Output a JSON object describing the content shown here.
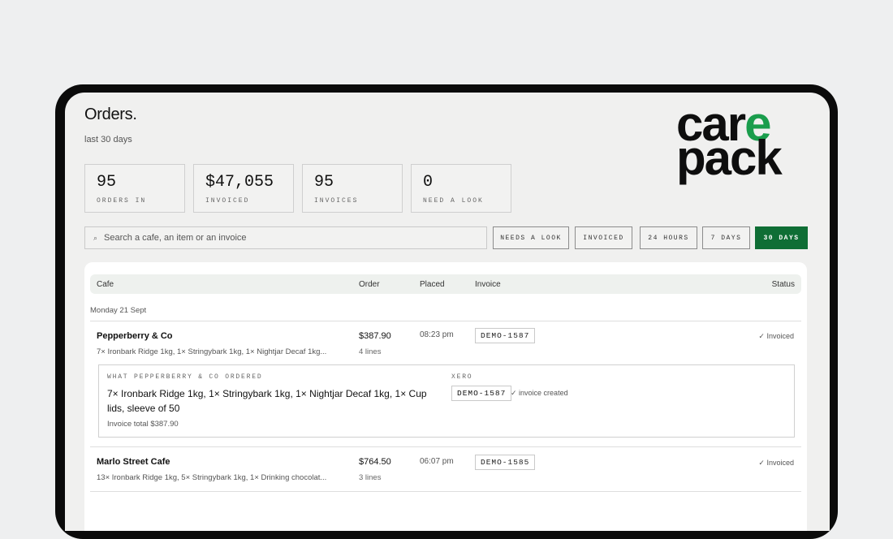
{
  "page": {
    "title": "Orders.",
    "subtitle": "last 30 days"
  },
  "brand": {
    "line1_a": "car",
    "line1_b": "e",
    "line2": "pack",
    "accent_color": "#1a9d4c"
  },
  "stats": [
    {
      "value": "95",
      "label": "ORDERS IN"
    },
    {
      "value": "$47,055",
      "label": "INVOICED"
    },
    {
      "value": "95",
      "label": "INVOICES"
    },
    {
      "value": "0",
      "label": "NEED A LOOK"
    }
  ],
  "search": {
    "icon": "search-icon",
    "placeholder": "Search a cafe, an item or an invoice"
  },
  "filters": [
    {
      "label": "NEEDS A LOOK",
      "active": false
    },
    {
      "label": "INVOICED",
      "active": false
    },
    {
      "label": "24 HOURS",
      "active": false
    },
    {
      "label": "7 DAYS",
      "active": false
    },
    {
      "label": "30 DAYS",
      "active": true
    }
  ],
  "table": {
    "headers": {
      "cafe": "Cafe",
      "order": "Order",
      "placed": "Placed",
      "invoice": "Invoice",
      "status": "Status"
    },
    "group_label": "Monday 21 Sept",
    "rows": [
      {
        "cafe": "Pepperberry & Co",
        "items": "7× Ironbark Ridge 1kg, 1× Stringybark 1kg, 1× Nightjar Decaf 1kg...",
        "amount": "$387.90",
        "lines": "4 lines",
        "placed": "08:23 pm",
        "invoice": "DEMO-1587",
        "status": "✓ Invoiced"
      },
      {
        "cafe": "Marlo Street Cafe",
        "items": "13× Ironbark Ridge 1kg, 5× Stringybark 1kg, 1× Drinking chocolat...",
        "amount": "$764.50",
        "lines": "3 lines",
        "placed": "06:07 pm",
        "invoice": "DEMO-1585",
        "status": "✓ Invoiced"
      }
    ],
    "detail": {
      "label": "WHAT PEPPERBERRY & CO ORDERED",
      "text": "7× Ironbark Ridge 1kg, 1× Stringybark 1kg, 1× Nightjar Decaf 1kg, 1× Cup lids, sleeve of 50",
      "total": "Invoice total $387.90",
      "xero_label": "XERO",
      "xero_invoice": "DEMO-1587",
      "xero_status": "✓ invoice created"
    }
  }
}
